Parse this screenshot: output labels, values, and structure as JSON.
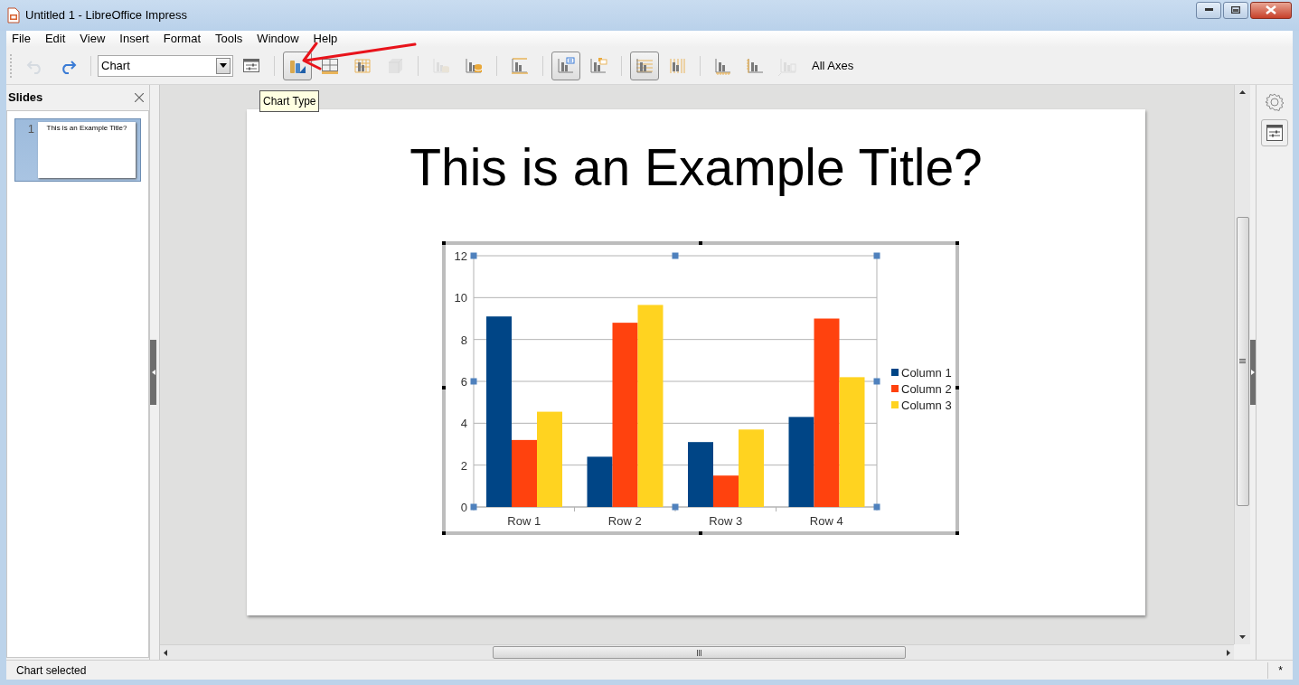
{
  "window": {
    "title": "Untitled 1 - LibreOffice Impress"
  },
  "menu": [
    "File",
    "Edit",
    "View",
    "Insert",
    "Format",
    "Tools",
    "Window",
    "Help"
  ],
  "toolbar": {
    "items": [
      {
        "kind": "undo",
        "disabled": true,
        "selected": false
      },
      {
        "kind": "redo",
        "disabled": false,
        "selected": false
      },
      {
        "kind": "separator"
      },
      {
        "kind": "dropdown",
        "value": "Chart"
      },
      {
        "kind": "format-selection",
        "disabled": false,
        "selected": false
      },
      {
        "kind": "separator"
      },
      {
        "kind": "chart-type",
        "disabled": false,
        "selected": true
      },
      {
        "kind": "chart-area",
        "disabled": false,
        "selected": false
      },
      {
        "kind": "chart-wall",
        "disabled": false,
        "selected": false
      },
      {
        "kind": "view-3d",
        "disabled": true,
        "selected": false
      },
      {
        "kind": "separator"
      },
      {
        "kind": "data-table",
        "disabled": true,
        "selected": false
      },
      {
        "kind": "data-ranges",
        "disabled": false,
        "selected": false
      },
      {
        "kind": "separator"
      },
      {
        "kind": "titles",
        "disabled": false,
        "selected": false
      },
      {
        "kind": "separator"
      },
      {
        "kind": "legend-toggle",
        "disabled": false,
        "selected": true
      },
      {
        "kind": "legend",
        "disabled": false,
        "selected": false
      },
      {
        "kind": "separator"
      },
      {
        "kind": "grid-horizontal",
        "disabled": false,
        "selected": true
      },
      {
        "kind": "grid-vertical",
        "disabled": false,
        "selected": false
      },
      {
        "kind": "separator"
      },
      {
        "kind": "axis-x",
        "disabled": false,
        "selected": false
      },
      {
        "kind": "axis-y",
        "disabled": false,
        "selected": false
      },
      {
        "kind": "axis-z",
        "disabled": true,
        "selected": false
      },
      {
        "kind": "text",
        "label": "All Axes"
      }
    ]
  },
  "tooltip": "Chart Type",
  "slides_panel": {
    "title": "Slides",
    "slides": [
      {
        "number": "1",
        "title": "This is an Example Title?",
        "selected": true
      }
    ]
  },
  "slide": {
    "title": "This is an Example Title?",
    "chart": {
      "chart_data": {
        "type": "bar",
        "categories": [
          "Row 1",
          "Row 2",
          "Row 3",
          "Row 4"
        ],
        "series": [
          {
            "name": "Column 1",
            "color": "#004586",
            "values": [
              9.1,
              2.4,
              3.1,
              4.3
            ]
          },
          {
            "name": "Column 2",
            "color": "#ff420e",
            "values": [
              3.2,
              8.8,
              1.5,
              9.0
            ]
          },
          {
            "name": "Column 3",
            "color": "#ffd320",
            "values": [
              4.55,
              9.65,
              3.7,
              6.2
            ]
          }
        ],
        "ylim": [
          0,
          12
        ],
        "yticks": [
          0,
          2,
          4,
          6,
          8,
          10,
          12
        ],
        "grid": true,
        "legend": "right"
      }
    }
  },
  "status_bar": {
    "message": "Chart selected",
    "modified": "*"
  }
}
